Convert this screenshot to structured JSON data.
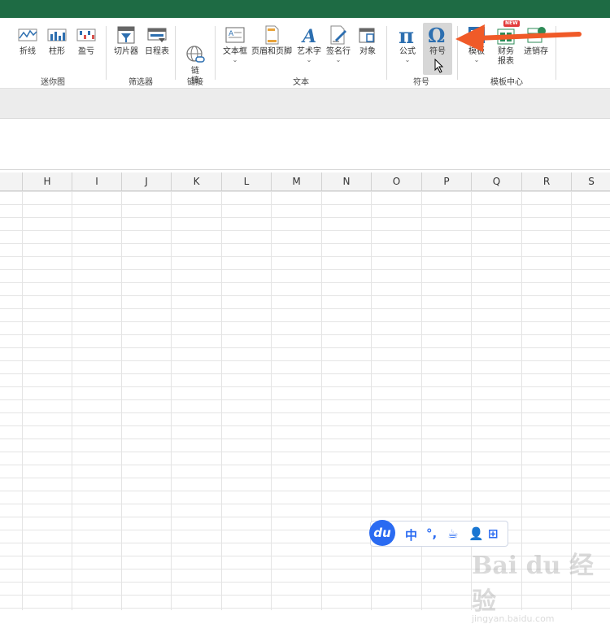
{
  "ribbon": {
    "groups": {
      "sparklines": {
        "label": "迷你图",
        "buttons": [
          "折线",
          "柱形",
          "盈亏"
        ]
      },
      "filters": {
        "label": "筛选器",
        "buttons": [
          "切片器",
          "日程表"
        ]
      },
      "links": {
        "label": "链接",
        "buttons": [
          "链\n接"
        ]
      },
      "text": {
        "label": "文本",
        "buttons": [
          "文本框",
          "页眉和页脚",
          "艺术字",
          "签名行",
          "对象"
        ]
      },
      "symbols": {
        "label": "符号",
        "buttons": [
          "公式",
          "符号"
        ]
      },
      "templates": {
        "label": "模板中心",
        "buttons": [
          "模板",
          "财务\n报表",
          "进销存"
        ],
        "new_badge": "NEW"
      }
    },
    "caret": "⌄"
  },
  "sheet": {
    "columns": [
      "H",
      "I",
      "J",
      "K",
      "L",
      "M",
      "N",
      "O",
      "P",
      "Q",
      "R",
      "S"
    ]
  },
  "ime": {
    "logo": "du",
    "items": [
      "中",
      "°,",
      "☕",
      "👤",
      "⊞"
    ]
  },
  "watermark": {
    "brand": "Bai du 经验",
    "url": "jingyan.baidu.com"
  },
  "colors": {
    "titlebar": "#1e6b44",
    "accent_blue": "#2a6bf2",
    "arrow": "#f05a28"
  }
}
